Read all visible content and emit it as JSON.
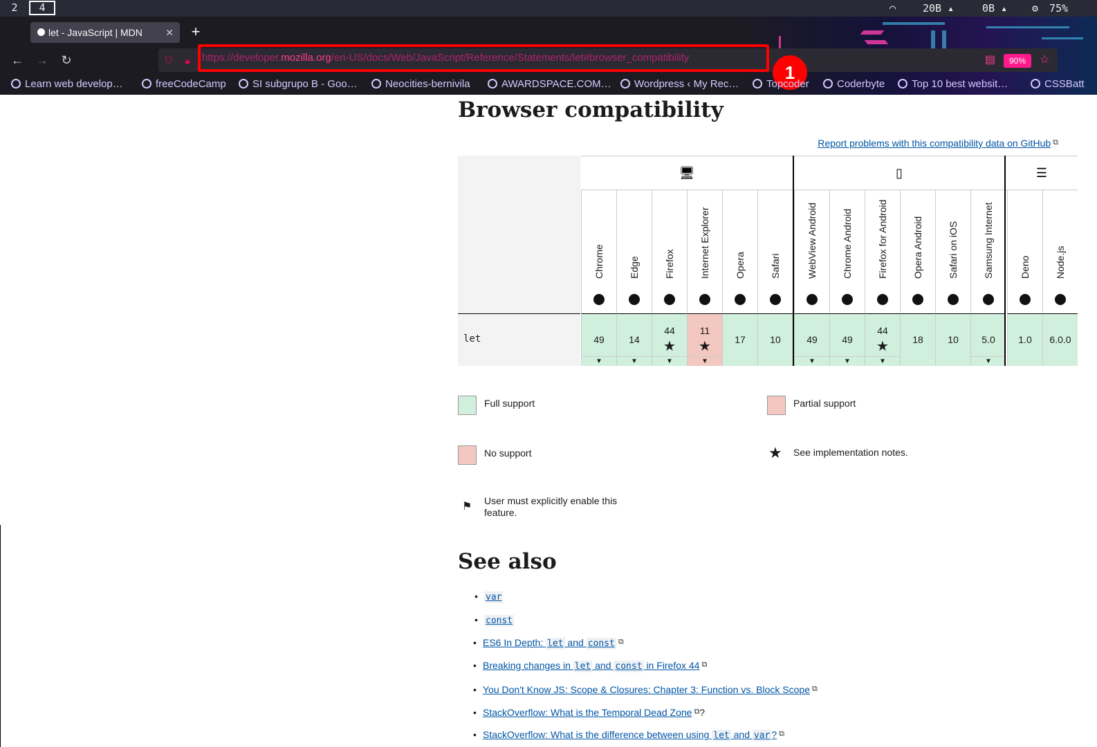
{
  "system": {
    "workspaces": [
      "2",
      "4"
    ],
    "download": "20B",
    "upload": "0B",
    "cpu": "75%"
  },
  "browser": {
    "tab_title": "let - JavaScript | MDN",
    "url_prefix": "https://developer.",
    "url_domain": "mozilla.org",
    "url_path": "/en-US/docs/Web/JavaScript/Reference/Statements/let#browser_compatibility",
    "annotation_number": "1",
    "zoom": "90%",
    "bookmarks": [
      "Learn web develop…",
      "freeCodeCamp",
      "SI subgrupo B - Goo…",
      "Neocities-bernivila",
      "AWARDSPACE.COM…",
      "Wordpress ‹ My Rec…",
      "Topcoder",
      "Coderbyte",
      "Top 10 best websit…",
      "CSSBatt"
    ]
  },
  "page": {
    "heading": "Browser compatibility",
    "report_link": "Report problems with this compatibility data on GitHub",
    "row_label": "let",
    "columns": [
      {
        "name": "Chrome",
        "value": "49",
        "star": false,
        "arrow": true,
        "partial": false
      },
      {
        "name": "Edge",
        "value": "14",
        "star": false,
        "arrow": true,
        "partial": false
      },
      {
        "name": "Firefox",
        "value": "44",
        "star": true,
        "arrow": true,
        "partial": false
      },
      {
        "name": "Internet Explorer",
        "value": "11",
        "star": true,
        "arrow": true,
        "partial": true
      },
      {
        "name": "Opera",
        "value": "17",
        "star": false,
        "arrow": false,
        "partial": false
      },
      {
        "name": "Safari",
        "value": "10",
        "star": false,
        "arrow": false,
        "partial": false
      },
      {
        "name": "WebView Android",
        "value": "49",
        "star": false,
        "arrow": true,
        "partial": false
      },
      {
        "name": "Chrome Android",
        "value": "49",
        "star": false,
        "arrow": true,
        "partial": false
      },
      {
        "name": "Firefox for Android",
        "value": "44",
        "star": true,
        "arrow": true,
        "partial": false
      },
      {
        "name": "Opera Android",
        "value": "18",
        "star": false,
        "arrow": false,
        "partial": false
      },
      {
        "name": "Safari on iOS",
        "value": "10",
        "star": false,
        "arrow": false,
        "partial": false
      },
      {
        "name": "Samsung Internet",
        "value": "5.0",
        "star": false,
        "arrow": true,
        "partial": false
      },
      {
        "name": "Deno",
        "value": "1.0",
        "star": false,
        "arrow": false,
        "partial": false
      },
      {
        "name": "Node.js",
        "value": "6.0.0",
        "star": false,
        "arrow": false,
        "partial": false
      }
    ],
    "legend": {
      "full": "Full support",
      "partial": "Partial support",
      "none": "No support",
      "notes": "See implementation notes.",
      "flag_line1": "User must explicitly enable this",
      "flag_line2": "feature."
    },
    "see_also_heading": "See also",
    "see_also": {
      "var": "var",
      "const": "const",
      "es6_pre": "ES6 In Depth: ",
      "es6_let": "let",
      "es6_and": " and ",
      "es6_const": "const",
      "bc_pre": "Breaking changes in ",
      "bc_let": "let",
      "bc_and": " and ",
      "bc_const": "const",
      "bc_post": " in Firefox 44",
      "ydkjs": "You Don't Know JS: Scope & Closures: Chapter 3: Function vs. Block Scope",
      "so_tdz": "StackOverflow: What is the Temporal Dead Zone",
      "so_tdz_tail": "?",
      "so_diff_pre": "StackOverflow: What is the difference between using ",
      "so_diff_let": "let",
      "so_diff_and": " and ",
      "so_diff_var": "var",
      "so_diff_post": "?"
    }
  }
}
